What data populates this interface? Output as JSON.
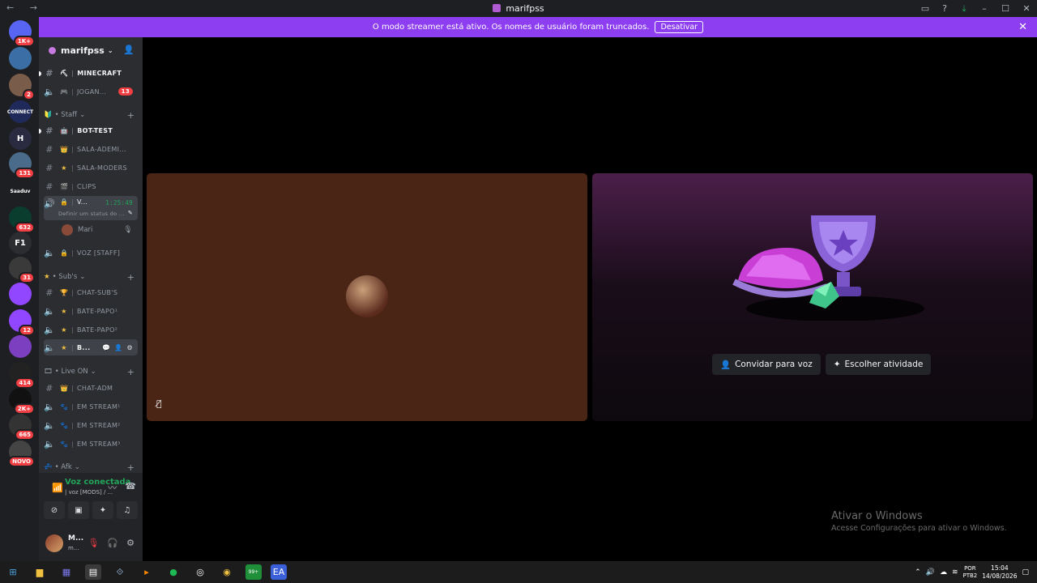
{
  "window": {
    "title": "marifpss",
    "nav_arrows": "← →"
  },
  "banner": {
    "text": "O modo streamer está ativo. Os nomes de usuário foram truncados.",
    "button": "Desativar"
  },
  "servers": [
    {
      "label": "",
      "badge": "1K+",
      "color": "#5865f2"
    },
    {
      "label": "",
      "badge": "",
      "color": "#3a6ea5"
    },
    {
      "label": "",
      "badge": "2",
      "color": "#7a5c4a"
    },
    {
      "label": "CONNECT",
      "badge": "",
      "color": "#1f2a5a"
    },
    {
      "label": "H",
      "badge": "",
      "color": "#2a2a40"
    },
    {
      "label": "",
      "badge": "131",
      "color": "#4a6b8a"
    },
    {
      "label": "Saaduv",
      "badge": "",
      "color": "#1e1f22"
    },
    {
      "label": "",
      "badge": "632",
      "color": "#0b3d2e"
    },
    {
      "label": "F1",
      "badge": "",
      "color": "#2b2d31"
    },
    {
      "label": "",
      "badge": "31",
      "color": "#3a3a3a"
    },
    {
      "label": "",
      "badge": "",
      "color": "#9146ff"
    },
    {
      "label": "",
      "badge": "12",
      "color": "#9146ff"
    },
    {
      "label": "",
      "badge": "",
      "color": "#7b3fbf"
    },
    {
      "label": "",
      "badge": "414",
      "color": "#222"
    },
    {
      "label": "",
      "badge": "2K+",
      "color": "#111"
    },
    {
      "label": "",
      "badge": "665",
      "color": "#333"
    },
    {
      "label": "",
      "badge": "NOVO",
      "color": "#444"
    }
  ],
  "server": {
    "name": "marifpss"
  },
  "channels": {
    "minecraft": "MINECRAFT",
    "jogan": "JOGAN...",
    "jogan_count": "13",
    "cat_staff": "• Staff",
    "bot_test": "BOT-TEST",
    "sala_adm": "SALA-ADEMI...",
    "sala_moders": "SALA-MODERS",
    "clips": "CLIPS",
    "voice_active": "V...",
    "voice_timer": "1:25:49",
    "voice_status": "Definir um status do ...",
    "member": "Mari",
    "voz_staff": "VOZ [STAFF]",
    "cat_subs": "• Sub's",
    "chat_subs": "CHAT-SUB'S",
    "bate1": "BATE-PAPO¹",
    "bate2": "BATE-PAPO²",
    "b_active": "B...",
    "cat_live": "• Live ON",
    "chat_adm": "CHAT-ADM",
    "stream1": "EM STREAM¹",
    "stream2": "EM STREAM²",
    "stream3": "EM STREAM³",
    "cat_afk": "• Afk"
  },
  "voice_panel": {
    "title": "Voz conectada",
    "subtitle": "| voz [MODS] / ..."
  },
  "user": {
    "name": "M...",
    "status": "m..."
  },
  "activity": {
    "invite_button": "Convidar para voz",
    "activity_button": "Escolher atividade"
  },
  "watermark": {
    "title": "Ativar o Windows",
    "subtitle": "Acesse Configurações para ativar o Windows."
  },
  "taskbar": {
    "lang1": "POR",
    "lang2": "PTB2",
    "time": "15:04",
    "date": "14/08/2026",
    "notif_badge": "99+"
  },
  "colors": {
    "accent": "#8c3ef0",
    "voice_green": "#23a55a",
    "badge_red": "#f23f43",
    "tile1_bg": "#4a2414"
  }
}
